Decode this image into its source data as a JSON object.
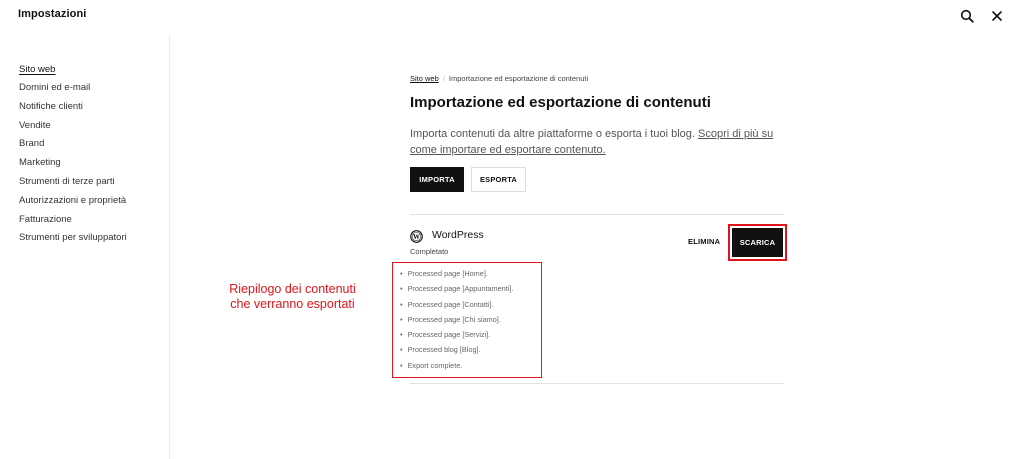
{
  "app": {
    "title": "Impostazioni"
  },
  "sidebar": {
    "items": [
      {
        "label": "Sito web"
      },
      {
        "label": "Domini ed e-mail"
      },
      {
        "label": "Notifiche clienti"
      },
      {
        "label": "Vendite"
      },
      {
        "label": "Brand"
      },
      {
        "label": "Marketing"
      },
      {
        "label": "Strumenti di terze parti"
      },
      {
        "label": "Autorizzazioni e proprietà"
      },
      {
        "label": "Fatturazione"
      },
      {
        "label": "Strumenti per sviluppatori"
      }
    ]
  },
  "breadcrumb": {
    "parent": "Sito web",
    "current": "Importazione ed esportazione di contenuti"
  },
  "page": {
    "title": "Importazione ed esportazione di contenuti",
    "description": "Importa contenuti da altre piattaforme o esporta i tuoi blog. ",
    "learn_more": "Scopri di più su come importare ed esportare contenuto."
  },
  "actions": {
    "import_label": "IMPORTA",
    "export_label": "ESPORTA"
  },
  "export_job": {
    "platform": "WordPress",
    "status": "Completato",
    "delete_label": "ELIMINA",
    "download_label": "SCARICA",
    "log": [
      "Processed page [Home].",
      "Processed page [Appuntamenti].",
      "Processed page [Contatti].",
      "Processed page [Chi siamo].",
      "Processed page [Servizi].",
      "Processed blog [Blog].",
      "Export complete."
    ]
  },
  "annotation": {
    "line1": "Riepilogo dei contenuti",
    "line2": "che verranno esportati"
  },
  "colors": {
    "accent": "#111111",
    "annotation_red": "#e0141b"
  },
  "icons": [
    "search-icon",
    "close-icon",
    "wordpress-icon"
  ]
}
